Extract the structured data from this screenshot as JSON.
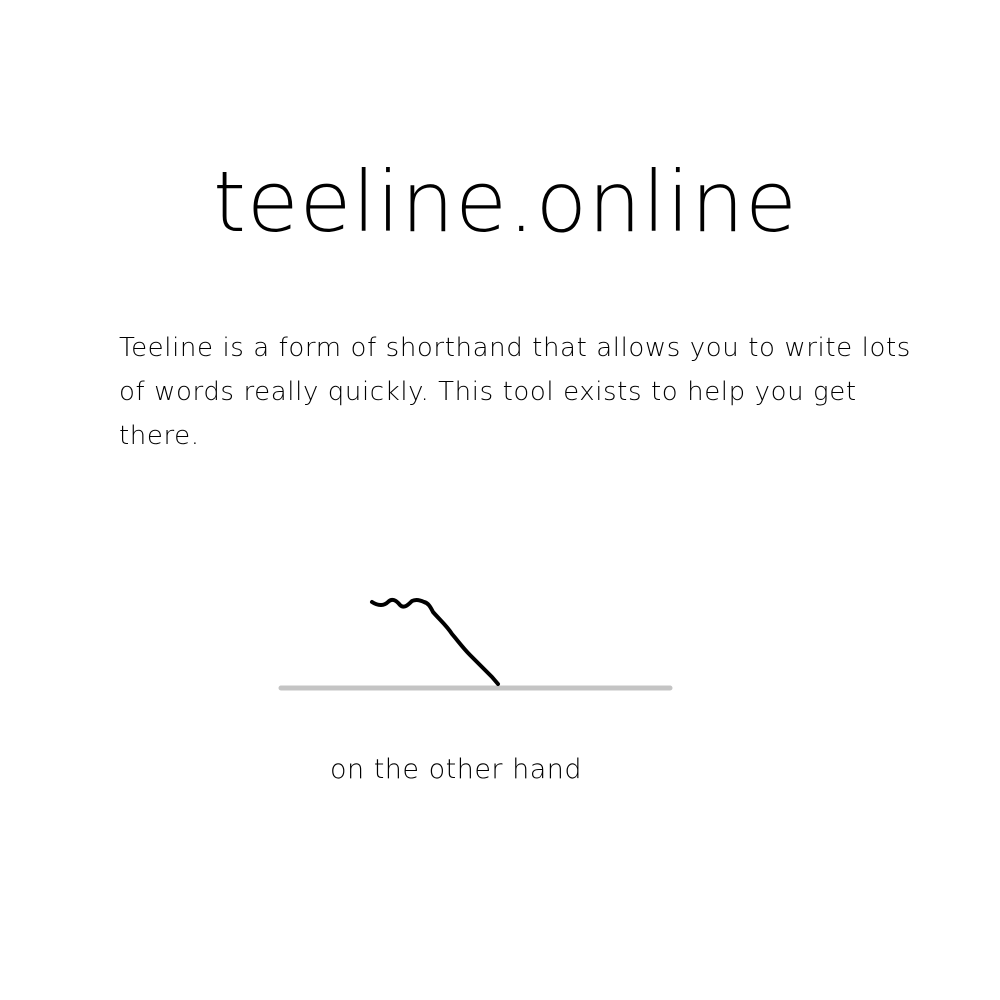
{
  "site": {
    "title": "teeline.online"
  },
  "intro": {
    "text": "Teeline is a form of shorthand that allows you to write lots of words really quickly. This tool exists to help you get there."
  },
  "practice": {
    "phrase": "on the other hand",
    "baseline_color": "#c4c4c4",
    "stroke_color": "#000000",
    "outline_icon": "shorthand-outline"
  }
}
